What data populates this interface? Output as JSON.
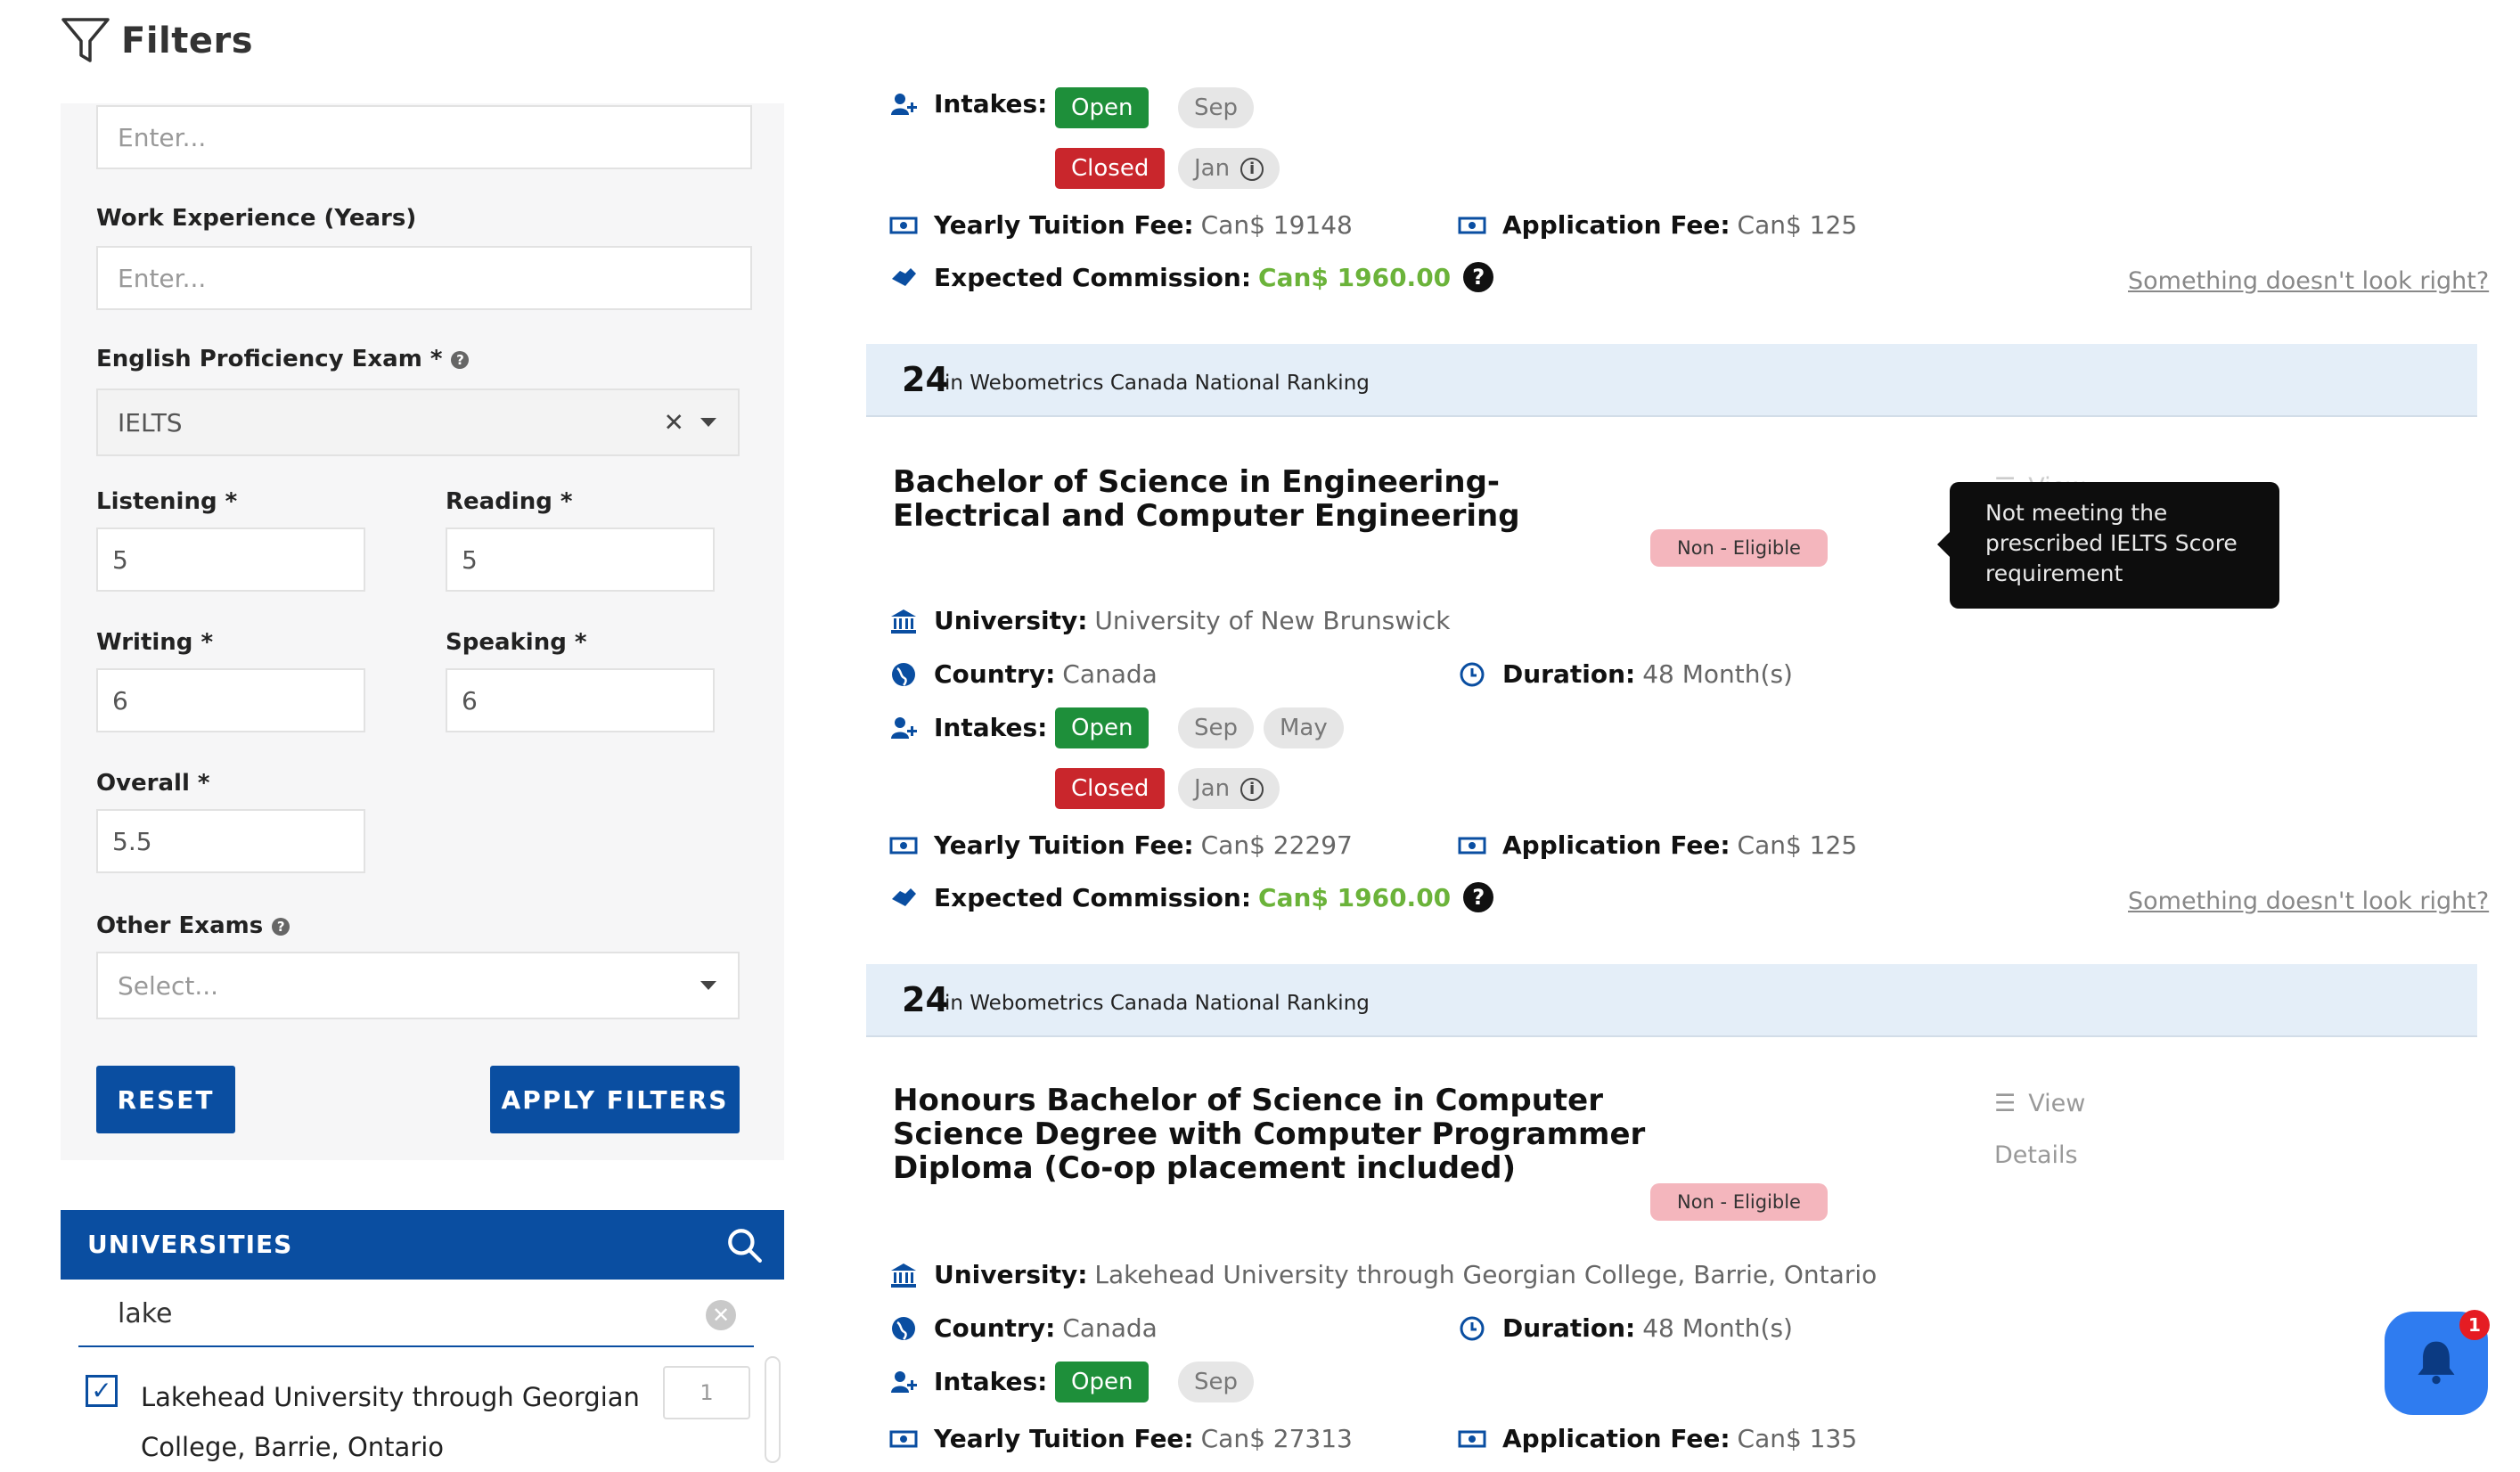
{
  "filters": {
    "title": "Filters",
    "top_input_placeholder": "Enter...",
    "work_experience": {
      "label": "Work Experience (Years)",
      "placeholder": "Enter..."
    },
    "english_exam": {
      "label": "English Proficiency Exam *",
      "value": "IELTS"
    },
    "listening": {
      "label": "Listening *",
      "value": "5"
    },
    "reading": {
      "label": "Reading *",
      "value": "5"
    },
    "writing": {
      "label": "Writing *",
      "value": "6"
    },
    "speaking": {
      "label": "Speaking *",
      "value": "6"
    },
    "overall": {
      "label": "Overall *",
      "value": "5.5"
    },
    "other_exams": {
      "label": "Other Exams",
      "placeholder": "Select..."
    },
    "reset_label": "RESET",
    "apply_label": "APPLY FILTERS"
  },
  "universities": {
    "title": "UNIVERSITIES",
    "search_value": "lake",
    "items": [
      {
        "name": "Lakehead University through Georgian College, Barrie, Ontario",
        "checked": true,
        "count": "1"
      }
    ]
  },
  "results": {
    "top_partial": {
      "intakes_label": "Intakes:",
      "open_label": "Open",
      "open_months": [
        "Sep"
      ],
      "closed_label": "Closed",
      "closed_months": [
        "Jan"
      ],
      "tuition_label": "Yearly Tuition Fee:",
      "tuition_value": "Can$ 19148",
      "app_fee_label": "Application Fee:",
      "app_fee_value": "Can$ 125",
      "commission_label": "Expected Commission:",
      "commission_value": "Can$ 1960.00",
      "report_link": "Something doesn't look right?"
    },
    "cards": [
      {
        "rank_number": "24",
        "rank_text": "in Webometrics Canada National Ranking",
        "title": "Bachelor of Science in Engineering- Electrical and Computer Engineering",
        "eligibility": "Non - Eligible",
        "tooltip": "Not meeting the prescribed IELTS Score requirement",
        "view_partial": "View",
        "university_label": "University:",
        "university_value": "University of New Brunswick",
        "country_label": "Country:",
        "country_value": "Canada",
        "duration_label": "Duration:",
        "duration_value": "48 Month(s)",
        "intakes_label": "Intakes:",
        "open_label": "Open",
        "open_months": [
          "Sep",
          "May"
        ],
        "closed_label": "Closed",
        "closed_months": [
          "Jan"
        ],
        "tuition_label": "Yearly Tuition Fee:",
        "tuition_value": "Can$ 22297",
        "app_fee_label": "Application Fee:",
        "app_fee_value": "Can$ 125",
        "commission_label": "Expected Commission:",
        "commission_value": "Can$ 1960.00",
        "report_link": "Something doesn't look right?"
      },
      {
        "rank_number": "24",
        "rank_text": "in Webometrics Canada National Ranking",
        "title": "Honours Bachelor of Science in Computer Science Degree with Computer Programmer Diploma (Co-op placement included)",
        "eligibility": "Non - Eligible",
        "view_label": "View",
        "details_label": "Details",
        "university_label": "University:",
        "university_value": "Lakehead University through Georgian College, Barrie, Ontario",
        "country_label": "Country:",
        "country_value": "Canada",
        "duration_label": "Duration:",
        "duration_value": "48 Month(s)",
        "intakes_label": "Intakes:",
        "open_label": "Open",
        "open_months": [
          "Sep"
        ],
        "tuition_label": "Yearly Tuition Fee:",
        "tuition_value": "Can$ 27313",
        "app_fee_label": "Application Fee:",
        "app_fee_value": "Can$ 135"
      }
    ]
  },
  "notification": {
    "count": "1"
  },
  "colors": {
    "primary": "#0a4ea1",
    "open": "#1e8f3a",
    "closed": "#c9262c",
    "commission": "#6bb33a",
    "rank_bar": "#e4eef8",
    "non_eligible": "#f4b6bd"
  }
}
